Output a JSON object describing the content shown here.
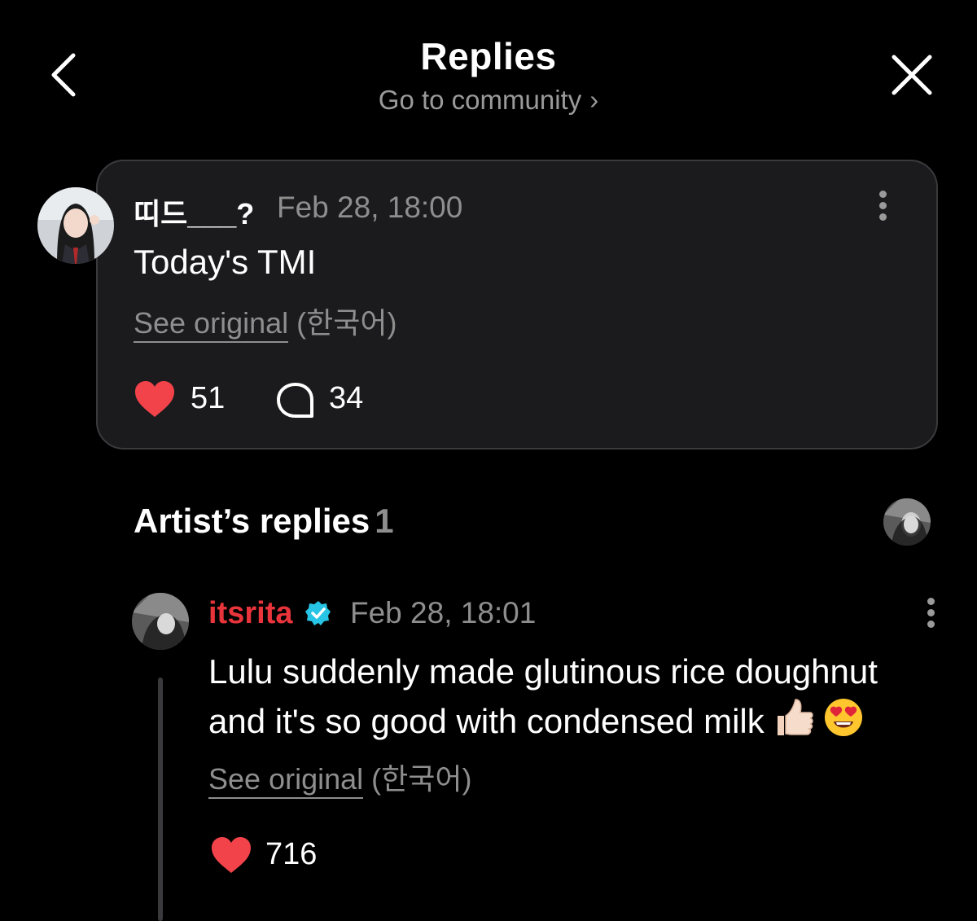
{
  "header": {
    "title": "Replies",
    "subtitle": "Go to community",
    "subtitle_chevron": "›",
    "back_icon": "chevron-left-icon",
    "close_icon": "close-icon"
  },
  "post": {
    "username": "띠드___?",
    "date": "Feb 28, 18:00",
    "text": "Today's TMI",
    "see_original": "See original",
    "language": "(한국어)",
    "likes": "51",
    "comments": "34"
  },
  "artist_replies": {
    "title": "Artist’s replies",
    "count": "1"
  },
  "reply": {
    "username": "itsrita",
    "date": "Feb 28, 18:01",
    "text_line1": "Lulu suddenly made glutinous rice doughnut",
    "text_line2": "and it's so good with condensed milk",
    "see_original": "See original",
    "language": "(한국어)",
    "likes": "716"
  },
  "colors": {
    "background": "#000000",
    "card": "#1b1b1d",
    "heart": "#f2434a",
    "artist_name": "#e8343b",
    "verified": "#27c4e6",
    "muted_text": "#8e8e8e"
  }
}
